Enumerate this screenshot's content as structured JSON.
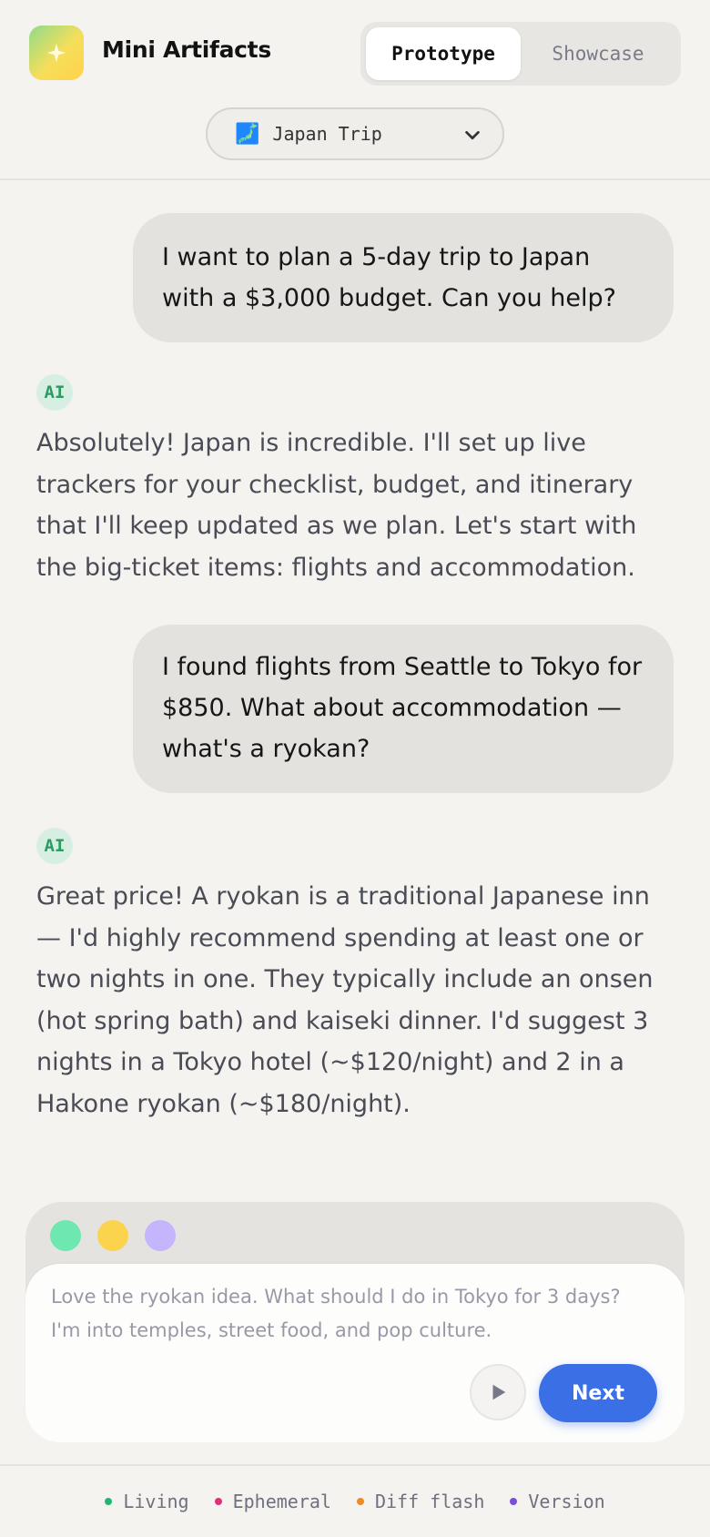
{
  "app": {
    "title": "Mini Artifacts",
    "logo_icon": "sparkle-icon"
  },
  "modes": {
    "items": [
      {
        "label": "Prototype",
        "active": true
      },
      {
        "label": "Showcase",
        "active": false
      }
    ]
  },
  "scenario": {
    "icon": "🗾",
    "selected": "Japan Trip"
  },
  "messages": [
    {
      "role": "user",
      "text": "I want to plan a 5-day trip to Japan with a $3,000 budget. Can you help?"
    },
    {
      "role": "ai",
      "badge": "AI",
      "text": "Absolutely! Japan is incredible. I'll set up live trackers for your checklist, budget, and itinerary that I'll keep updated as we plan. Let's start with the big-ticket items: flights and accommodation."
    },
    {
      "role": "user",
      "text": "I found flights from Seattle to Tokyo for $850. What about accommodation — what's a ryokan?"
    },
    {
      "role": "ai",
      "badge": "AI",
      "text": "Great price! A ryokan is a traditional Japanese inn — I'd highly recommend spending at least one or two nights in one. They typically include an onsen (hot spring bath) and kaiseki dinner. I'd suggest 3 nights in a Tokyo hotel (~$120/night) and 2 in a Hakone ryokan (~$180/night)."
    }
  ],
  "composer": {
    "dot_colors": [
      "#6ee7b0",
      "#fcd34d",
      "#c4b5fd"
    ],
    "draft": "Love the ryokan idea. What should I do in Tokyo for 3 days? I'm into temples, street food, and pop culture.",
    "play_icon": "play-icon",
    "next_label": "Next"
  },
  "legend": [
    {
      "label": "Living",
      "color": "#22b573"
    },
    {
      "label": "Ephemeral",
      "color": "#e0307a"
    },
    {
      "label": "Diff flash",
      "color": "#f08a24"
    },
    {
      "label": "Version",
      "color": "#7c4ddb"
    }
  ],
  "colors": {
    "accent": "#3a6fe6",
    "background": "#f4f3f0",
    "ai_badge": "#2c9a63"
  }
}
